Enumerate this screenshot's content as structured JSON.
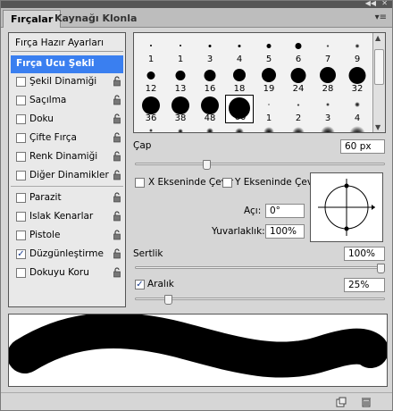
{
  "tabs": [
    {
      "label": "Fırçalar"
    },
    {
      "label": "Kaynağı Klonla"
    }
  ],
  "left_panel": {
    "presets_label": "Fırça Hazır Ayarları",
    "items": [
      {
        "label": "Fırça Ucu Şekli",
        "selected": true,
        "checked": false,
        "has_checkbox": false,
        "locked": false
      },
      {
        "label": "Şekil Dinamiği",
        "checked": false,
        "has_checkbox": true,
        "locked": true
      },
      {
        "label": "Saçılma",
        "checked": false,
        "has_checkbox": true,
        "locked": true
      },
      {
        "label": "Doku",
        "checked": false,
        "has_checkbox": true,
        "locked": true
      },
      {
        "label": "Çifte Fırça",
        "checked": false,
        "has_checkbox": true,
        "locked": true
      },
      {
        "label": "Renk Dinamiği",
        "checked": false,
        "has_checkbox": true,
        "locked": true
      },
      {
        "label": "Diğer Dinamikler",
        "checked": false,
        "has_checkbox": true,
        "locked": true
      },
      {
        "label": "Parazit",
        "checked": false,
        "has_checkbox": true,
        "locked": true
      },
      {
        "label": "Islak Kenarlar",
        "checked": false,
        "has_checkbox": true,
        "locked": true
      },
      {
        "label": "Pistole",
        "checked": false,
        "has_checkbox": true,
        "locked": true
      },
      {
        "label": "Düzgünleştirme",
        "checked": true,
        "has_checkbox": true,
        "locked": true
      },
      {
        "label": "Dokuyu Koru",
        "checked": false,
        "has_checkbox": true,
        "locked": true
      }
    ]
  },
  "brush_tips": [
    {
      "size": "1",
      "kind": "hard"
    },
    {
      "size": "3",
      "kind": "hard"
    },
    {
      "size": "5",
      "kind": "hard"
    },
    {
      "size": "9",
      "kind": "hard"
    },
    {
      "size": "13",
      "kind": "hard"
    },
    {
      "size": "19",
      "kind": "hard"
    },
    {
      "size": "5",
      "kind": "soft"
    },
    {
      "size": "9",
      "kind": "soft"
    },
    {
      "size": "13",
      "kind": "hard"
    },
    {
      "size": "17",
      "kind": "hard"
    },
    {
      "size": "21",
      "kind": "hard"
    },
    {
      "size": "27",
      "kind": "hard"
    },
    {
      "size": "35",
      "kind": "hard"
    },
    {
      "size": "45",
      "kind": "hard"
    },
    {
      "size": "65",
      "kind": "hard"
    },
    {
      "size": "100",
      "kind": "hard"
    },
    {
      "size": "200",
      "kind": "hard"
    },
    {
      "size": "300",
      "kind": "hard"
    },
    {
      "size": "9",
      "kind": "soft"
    },
    {
      "size": "13",
      "kind": "soft"
    }
  ],
  "brush_tip_labels": [
    "1",
    "1",
    "3",
    "4",
    "5",
    "6",
    "7",
    "9",
    "12",
    "13",
    "16",
    "18",
    "19",
    "24",
    "28",
    "32",
    "36",
    "38",
    "48",
    "60",
    "1",
    "2",
    "3",
    "4"
  ],
  "selected_tip_label": "60",
  "diameter": {
    "label": "Çap",
    "value": "60 px",
    "fraction": 0.28
  },
  "flip": {
    "x_label": "X Ekseninde Çevir",
    "y_label": "Y Ekseninde Çevir",
    "x_checked": false,
    "y_checked": false
  },
  "angle": {
    "label": "Açı:",
    "value": "0°"
  },
  "roundness": {
    "label": "Yuvarlaklık:",
    "value": "100%"
  },
  "hardness": {
    "label": "Sertlik",
    "value": "100%",
    "fraction": 1.0
  },
  "spacing": {
    "label": "Aralık",
    "value": "25%",
    "checked": true,
    "fraction": 0.12
  },
  "icons": {
    "menu": "panel-menu-icon",
    "lock": "lock-icon",
    "new": "new-preset-icon",
    "trash": "trash-icon"
  }
}
